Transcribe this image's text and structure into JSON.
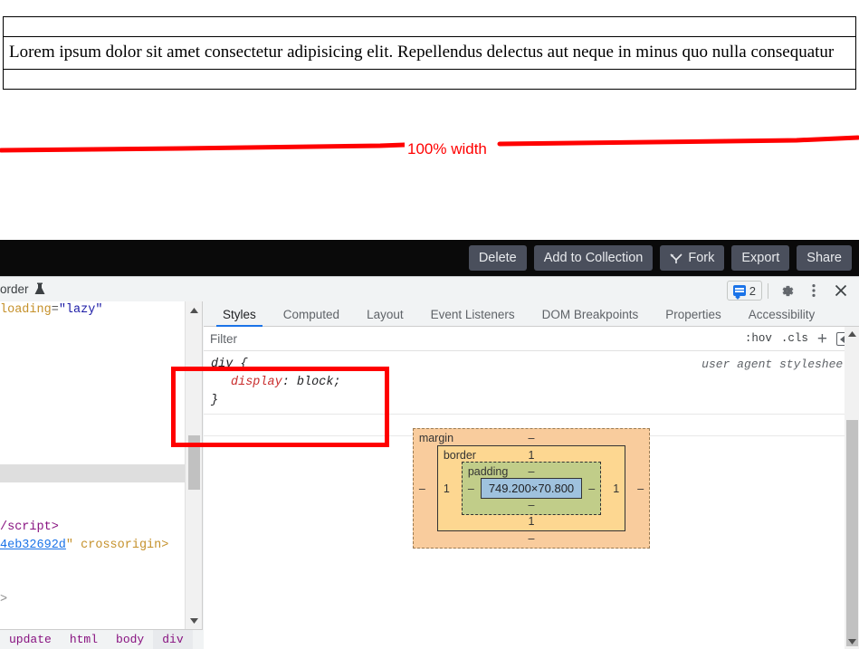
{
  "page": {
    "demo_text": "Lorem ipsum dolor sit amet consectetur adipisicing elit. Repellendus delectus aut neque in minus quo nulla consequatur",
    "annotation_label": "100% width",
    "annotation_color": "#ff0000"
  },
  "toolbar": {
    "buttons": [
      {
        "label": "Delete",
        "icon": ""
      },
      {
        "label": "Add to Collection",
        "icon": ""
      },
      {
        "label": "Fork",
        "icon": "fork-icon"
      },
      {
        "label": "Export",
        "icon": ""
      },
      {
        "label": "Share",
        "icon": ""
      }
    ]
  },
  "devtools": {
    "panel_tab_clipped": "order",
    "panel_tab_icon": "flask-icon",
    "message_count": "2",
    "icons": [
      "message-icon",
      "gear-icon",
      "kebab-menu-icon",
      "close-icon"
    ],
    "dom": {
      "lines": [
        {
          "type": "attr",
          "attr": "loading",
          "value": "\"lazy\""
        },
        {
          "type": "blank"
        },
        {
          "type": "blank"
        },
        {
          "type": "blank"
        },
        {
          "type": "blank"
        },
        {
          "type": "blank"
        },
        {
          "type": "blank"
        },
        {
          "type": "blank"
        },
        {
          "type": "selected"
        },
        {
          "type": "blank"
        },
        {
          "type": "blank"
        },
        {
          "type": "closetag",
          "text": "/script>"
        },
        {
          "type": "link",
          "link": "4eb32692d",
          "quote": "\"",
          "after": "crossorigin>"
        },
        {
          "type": "blank"
        },
        {
          "type": "blank"
        },
        {
          "type": "punc",
          "text": ">"
        }
      ],
      "breadcrumb": [
        "update",
        "html",
        "body",
        "div",
        "..."
      ],
      "breadcrumb_active": "div"
    },
    "styles": {
      "tabs": [
        "Styles",
        "Computed",
        "Layout",
        "Event Listeners",
        "DOM Breakpoints",
        "Properties",
        "Accessibility"
      ],
      "active_tab": "Styles",
      "filter_placeholder": "Filter",
      "filter_value": "",
      "tools": {
        "hov": ":hov",
        "cls": ".cls",
        "new_rule": "+",
        "toggle_sidebar": "sidebar-toggle-icon"
      },
      "rule": {
        "selector": "div {",
        "property": "display",
        "value": "block;",
        "close": "}",
        "origin": "user agent stylesheet"
      }
    },
    "box_model": {
      "margin_label": "margin",
      "margin_top": "–",
      "margin_right": "–",
      "margin_bottom": "–",
      "margin_left": "–",
      "border_label": "border",
      "border_top": "1",
      "border_right": "1",
      "border_bottom": "1",
      "border_left": "1",
      "padding_label": "padding",
      "padding_top": "–",
      "padding_right": "–",
      "padding_bottom": "–",
      "padding_left": "–",
      "content_size": "749.200×70.800",
      "colors": {
        "margin": "#f9cc9d",
        "border": "#fdd791",
        "padding": "#c1cd89",
        "content": "#9fc2de"
      }
    }
  }
}
